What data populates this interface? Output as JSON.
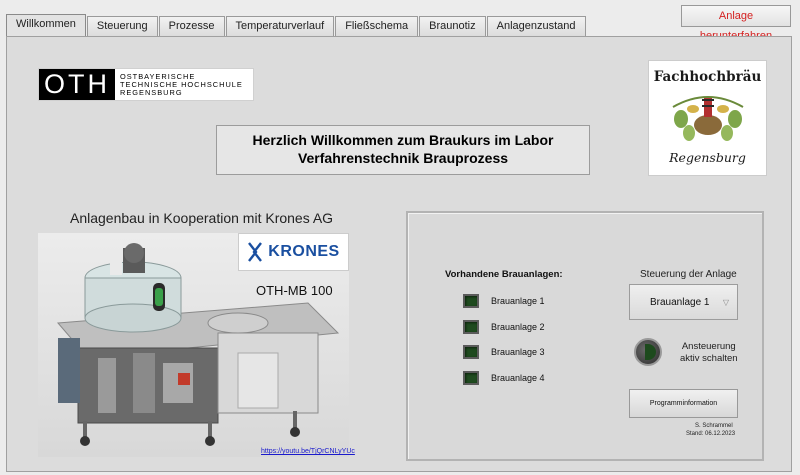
{
  "tabs": [
    {
      "label": "Willkommen",
      "active": true
    },
    {
      "label": "Steuerung"
    },
    {
      "label": "Prozesse"
    },
    {
      "label": "Temperaturverlauf"
    },
    {
      "label": "Fließschema"
    },
    {
      "label": "Braunotiz"
    },
    {
      "label": "Anlagenzustand"
    }
  ],
  "header": {
    "shutdown_label": "Anlage herunterfahren"
  },
  "oth_logo": {
    "mark": "OTH",
    "line1": "OSTBAYERISCHE",
    "line2": "TECHNISCHE HOCHSCHULE",
    "line3": "REGENSBURG"
  },
  "brau_logo": {
    "top": "Fachhochbräu",
    "bottom": "Regensburg"
  },
  "welcome": {
    "line1": "Herzlich Willkommen zum Braukurs im Labor",
    "line2": "Verfahrenstechnik Brauprozess"
  },
  "cooperation_text": "Anlagenbau in Kooperation mit Krones AG",
  "krones_logo": "KRONES",
  "model_name": "OTH-MB 100",
  "video_link": "https://youtu.be/TjQrCNLyYUc",
  "control": {
    "anlagen_title": "Vorhandene Brauanlagen:",
    "anlagen": [
      "Brauanlage 1",
      "Brauanlage 2",
      "Brauanlage 3",
      "Brauanlage 4"
    ],
    "led_color": "#1f4a1f",
    "steuerung_title": "Steuerung der Anlage",
    "selected_anlage": "Brauanlage 1",
    "toggle_label_1": "Ansteuerung",
    "toggle_label_2": "aktiv schalten",
    "program_button": "Programminformation",
    "author": "S. Schrammel",
    "stand": "Stand: 06.12.2023"
  },
  "colors": {
    "shutdown_text": "#d42020",
    "krones_blue": "#1a4fa0"
  }
}
